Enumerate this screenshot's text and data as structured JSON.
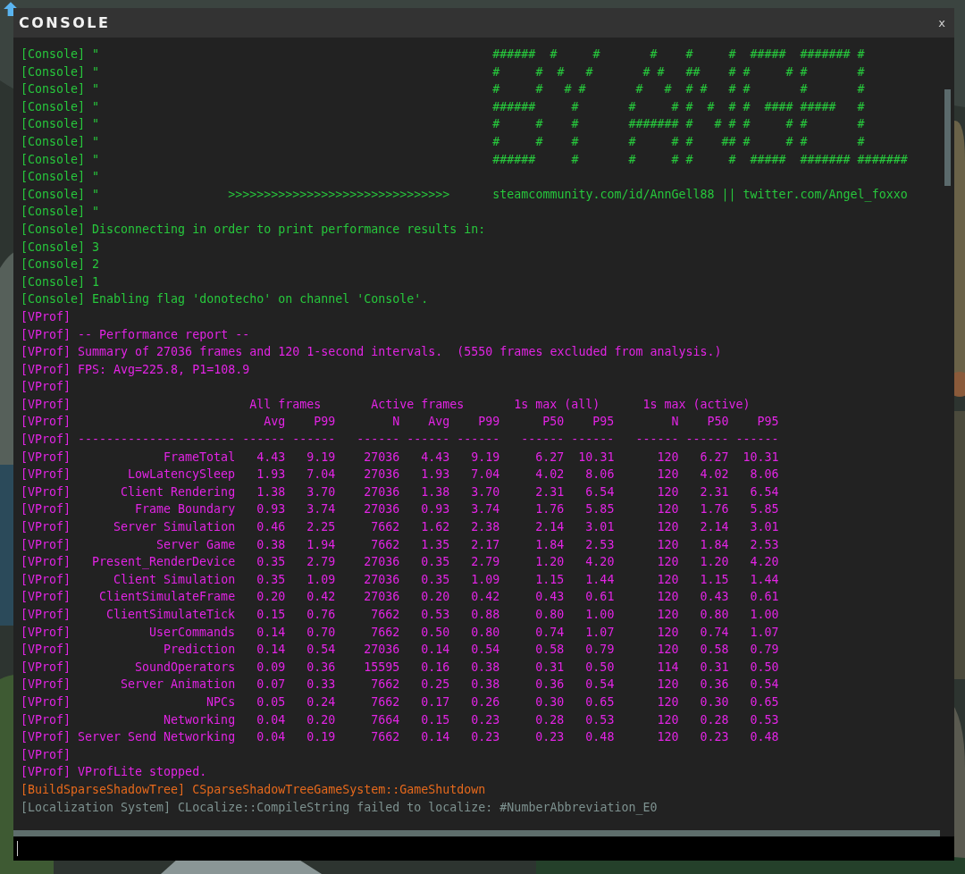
{
  "window": {
    "title": "CONSOLE",
    "close": "x"
  },
  "log": [
    {
      "kind": "console",
      "text": "[Console] \"",
      "aside": "######  #     #       #    #     #  #####  ####### #"
    },
    {
      "kind": "console",
      "text": "[Console] \"",
      "aside": "#     #  #   #       # #   ##    # #     # #       #"
    },
    {
      "kind": "console",
      "text": "[Console] \"",
      "aside": "#     #   # #       #   #  # #   # #       #       #"
    },
    {
      "kind": "console",
      "text": "[Console] \"",
      "aside": "######     #       #     # #  #  # #  #### #####   #"
    },
    {
      "kind": "console",
      "text": "[Console] \"",
      "aside": "#     #    #       ####### #   # # #     # #       #"
    },
    {
      "kind": "console",
      "text": "[Console] \"",
      "aside": "#     #    #       #     # #    ## #     # #       #"
    },
    {
      "kind": "console",
      "text": "[Console] \"",
      "aside": "######     #       #     # #     #  #####  ####### #######"
    },
    {
      "kind": "console",
      "text": "[Console] \""
    },
    {
      "kind": "console",
      "text": "[Console] \"",
      "arrow": ">>>>>>>>>>>>>>>>>>>>>>>>>>>>>>>",
      "aside": "steamcommunity.com/id/AnnGell88 || twitter.com/Angel_foxxo"
    },
    {
      "kind": "console",
      "text": "[Console] \""
    },
    {
      "kind": "console",
      "text": "[Console] Disconnecting in order to print performance results in:"
    },
    {
      "kind": "console",
      "text": "[Console] 3"
    },
    {
      "kind": "console",
      "text": "[Console] 2"
    },
    {
      "kind": "console",
      "text": "[Console] 1"
    },
    {
      "kind": "console",
      "text": "[Console] Enabling flag 'donotecho' on channel 'Console'."
    },
    {
      "kind": "vprof",
      "text": "[VProf]"
    },
    {
      "kind": "vprof",
      "text": "[VProf] -- Performance report --"
    },
    {
      "kind": "vprof",
      "text": "[VProf] Summary of 27036 frames and 120 1-second intervals.  (5550 frames excluded from analysis.)"
    },
    {
      "kind": "vprof",
      "text": "[VProf] FPS: Avg=225.8, P1=108.9"
    },
    {
      "kind": "vprof",
      "text": "[VProf]"
    },
    {
      "kind": "vprof_groups",
      "tag": "[VProf]",
      "groups": [
        "All frames",
        "Active frames",
        "1s max (all)",
        "1s max (active)"
      ]
    },
    {
      "kind": "vprof_row",
      "tag": "[VProf]",
      "values": [
        "Avg",
        "P99",
        "N",
        "Avg",
        "P99",
        "P50",
        "P95",
        "N",
        "P50",
        "P95"
      ]
    },
    {
      "kind": "vprof_row",
      "tag": "[VProf]",
      "name": "----------------------",
      "values": [
        "------",
        "------",
        "------",
        "------",
        "------",
        "------",
        "------",
        "------",
        "------",
        "------"
      ]
    },
    {
      "kind": "vprof_row",
      "tag": "[VProf]",
      "name": "FrameTotal",
      "values": [
        "4.43",
        "9.19",
        "27036",
        "4.43",
        "9.19",
        "6.27",
        "10.31",
        "120",
        "6.27",
        "10.31"
      ]
    },
    {
      "kind": "vprof_row",
      "tag": "[VProf]",
      "name": "LowLatencySleep",
      "values": [
        "1.93",
        "7.04",
        "27036",
        "1.93",
        "7.04",
        "4.02",
        "8.06",
        "120",
        "4.02",
        "8.06"
      ]
    },
    {
      "kind": "vprof_row",
      "tag": "[VProf]",
      "name": "Client Rendering",
      "values": [
        "1.38",
        "3.70",
        "27036",
        "1.38",
        "3.70",
        "2.31",
        "6.54",
        "120",
        "2.31",
        "6.54"
      ]
    },
    {
      "kind": "vprof_row",
      "tag": "[VProf]",
      "name": "Frame Boundary",
      "values": [
        "0.93",
        "3.74",
        "27036",
        "0.93",
        "3.74",
        "1.76",
        "5.85",
        "120",
        "1.76",
        "5.85"
      ]
    },
    {
      "kind": "vprof_row",
      "tag": "[VProf]",
      "name": "Server Simulation",
      "values": [
        "0.46",
        "2.25",
        "7662",
        "1.62",
        "2.38",
        "2.14",
        "3.01",
        "120",
        "2.14",
        "3.01"
      ]
    },
    {
      "kind": "vprof_row",
      "tag": "[VProf]",
      "name": "Server Game",
      "values": [
        "0.38",
        "1.94",
        "7662",
        "1.35",
        "2.17",
        "1.84",
        "2.53",
        "120",
        "1.84",
        "2.53"
      ]
    },
    {
      "kind": "vprof_row",
      "tag": "[VProf]",
      "name": "Present_RenderDevice",
      "values": [
        "0.35",
        "2.79",
        "27036",
        "0.35",
        "2.79",
        "1.20",
        "4.20",
        "120",
        "1.20",
        "4.20"
      ]
    },
    {
      "kind": "vprof_row",
      "tag": "[VProf]",
      "name": "Client Simulation",
      "values": [
        "0.35",
        "1.09",
        "27036",
        "0.35",
        "1.09",
        "1.15",
        "1.44",
        "120",
        "1.15",
        "1.44"
      ]
    },
    {
      "kind": "vprof_row",
      "tag": "[VProf]",
      "name": "ClientSimulateFrame",
      "values": [
        "0.20",
        "0.42",
        "27036",
        "0.20",
        "0.42",
        "0.43",
        "0.61",
        "120",
        "0.43",
        "0.61"
      ]
    },
    {
      "kind": "vprof_row",
      "tag": "[VProf]",
      "name": "ClientSimulateTick",
      "values": [
        "0.15",
        "0.76",
        "7662",
        "0.53",
        "0.88",
        "0.80",
        "1.00",
        "120",
        "0.80",
        "1.00"
      ]
    },
    {
      "kind": "vprof_row",
      "tag": "[VProf]",
      "name": "UserCommands",
      "values": [
        "0.14",
        "0.70",
        "7662",
        "0.50",
        "0.80",
        "0.74",
        "1.07",
        "120",
        "0.74",
        "1.07"
      ]
    },
    {
      "kind": "vprof_row",
      "tag": "[VProf]",
      "name": "Prediction",
      "values": [
        "0.14",
        "0.54",
        "27036",
        "0.14",
        "0.54",
        "0.58",
        "0.79",
        "120",
        "0.58",
        "0.79"
      ]
    },
    {
      "kind": "vprof_row",
      "tag": "[VProf]",
      "name": "SoundOperators",
      "values": [
        "0.09",
        "0.36",
        "15595",
        "0.16",
        "0.38",
        "0.31",
        "0.50",
        "114",
        "0.31",
        "0.50"
      ]
    },
    {
      "kind": "vprof_row",
      "tag": "[VProf]",
      "name": "Server Animation",
      "values": [
        "0.07",
        "0.33",
        "7662",
        "0.25",
        "0.38",
        "0.36",
        "0.54",
        "120",
        "0.36",
        "0.54"
      ]
    },
    {
      "kind": "vprof_row",
      "tag": "[VProf]",
      "name": "NPCs",
      "values": [
        "0.05",
        "0.24",
        "7662",
        "0.17",
        "0.26",
        "0.30",
        "0.65",
        "120",
        "0.30",
        "0.65"
      ]
    },
    {
      "kind": "vprof_row",
      "tag": "[VProf]",
      "name": "Networking",
      "values": [
        "0.04",
        "0.20",
        "7664",
        "0.15",
        "0.23",
        "0.28",
        "0.53",
        "120",
        "0.28",
        "0.53"
      ]
    },
    {
      "kind": "vprof_row",
      "tag": "[VProf]",
      "name": "Server Send Networking",
      "values": [
        "0.04",
        "0.19",
        "7662",
        "0.14",
        "0.23",
        "0.23",
        "0.48",
        "120",
        "0.23",
        "0.48"
      ]
    },
    {
      "kind": "vprof",
      "text": "[VProf]"
    },
    {
      "kind": "vprof",
      "text": "[VProf] VProfLite stopped."
    },
    {
      "kind": "build",
      "text": "[BuildSparseShadowTree] CSparseShadowTreeGameSystem::GameShutdown"
    },
    {
      "kind": "localization",
      "text": "[Localization System] CLocalize::CompileString failed to localize: #NumberAbbreviation_E0"
    }
  ]
}
